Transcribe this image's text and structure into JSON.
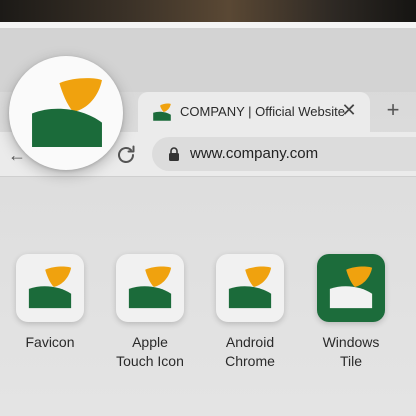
{
  "colors": {
    "brand_green": "#1b6b3a",
    "brand_orange": "#f0a20e",
    "tile_background": "#1c6c3b"
  },
  "browser": {
    "tab": {
      "title": "COMPANY | Official Website",
      "favicon": "company-logo-icon",
      "close_icon": "close-icon",
      "close_glyph": "✕"
    },
    "new_tab": {
      "icon": "plus-icon",
      "glyph": "+"
    },
    "toolbar": {
      "back_icon": "back-arrow-icon",
      "back_glyph": "←",
      "reload_icon": "reload-icon",
      "lock_icon": "lock-icon",
      "url": "www.company.com"
    }
  },
  "magnified_favicon": {
    "icon": "company-logo-icon"
  },
  "app_icons": [
    {
      "label": "Favicon",
      "style": "light"
    },
    {
      "label": "Apple\nTouch Icon",
      "style": "light"
    },
    {
      "label": "Android\nChrome",
      "style": "light"
    },
    {
      "label": "Windows\nTile",
      "style": "dark"
    }
  ]
}
